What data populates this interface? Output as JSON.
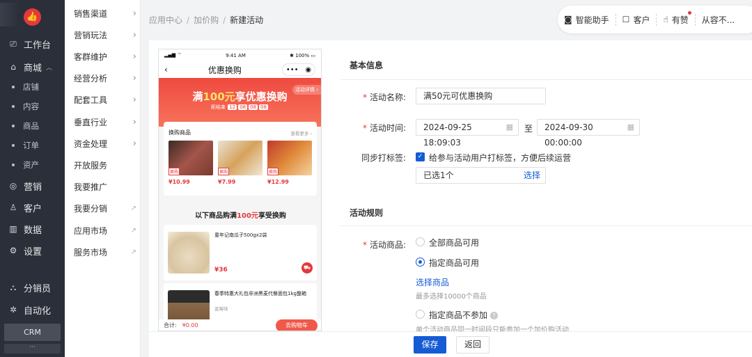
{
  "sidebar": {
    "items": [
      {
        "label": "工作台",
        "icon": "workbench-icon",
        "glyph": "⎚"
      },
      {
        "label": "商城",
        "icon": "shop-icon",
        "glyph": "⌂",
        "expanded": true
      },
      {
        "label": "店铺",
        "sub": true
      },
      {
        "label": "内容",
        "sub": true
      },
      {
        "label": "商品",
        "sub": true
      },
      {
        "label": "订单",
        "sub": true
      },
      {
        "label": "资产",
        "sub": true
      },
      {
        "label": "营销",
        "icon": "marketing-icon",
        "glyph": "◎"
      },
      {
        "label": "客户",
        "icon": "customer-icon",
        "glyph": "♙"
      },
      {
        "label": "数据",
        "icon": "data-icon",
        "glyph": "▥"
      },
      {
        "label": "设置",
        "icon": "settings-icon",
        "glyph": "⚙"
      },
      {
        "label": "分销员",
        "icon": "distributor-icon",
        "glyph": "⛬"
      },
      {
        "label": "自动化",
        "icon": "automation-icon",
        "glyph": "✲"
      }
    ],
    "crm": "CRM",
    "more": "···"
  },
  "submenu": {
    "items": [
      {
        "label": "销售渠道",
        "arrow": "chevron"
      },
      {
        "label": "营销玩法",
        "arrow": "chevron"
      },
      {
        "label": "客群维护",
        "arrow": "chevron"
      },
      {
        "label": "经营分析",
        "arrow": "chevron"
      },
      {
        "label": "配套工具",
        "arrow": "chevron"
      },
      {
        "label": "垂直行业",
        "arrow": "chevron"
      },
      {
        "label": "资金处理",
        "arrow": "chevron"
      },
      {
        "label": "开放服务",
        "arrow": "none"
      },
      {
        "label": "我要推广",
        "arrow": "none"
      },
      {
        "label": "我要分销",
        "arrow": "external"
      },
      {
        "label": "应用市场",
        "arrow": "external"
      },
      {
        "label": "服务市场",
        "arrow": "external"
      }
    ]
  },
  "breadcrumb": {
    "items": [
      "应用中心",
      "加价购",
      "新建活动"
    ],
    "sep": "/"
  },
  "topbar": {
    "assistant": "智能助手",
    "service": "客户",
    "likes": "有赞",
    "user": "从容不..."
  },
  "preview": {
    "status_time": "9:41 AM",
    "status_batt": "100%",
    "nav_title": "优惠换购",
    "banner_pre": "满",
    "banner_amount": "100元",
    "banner_post": "享优惠换购",
    "banner_tag": "活动详情 ›",
    "countdown_label": "距结束",
    "countdown": [
      "12",
      "08",
      "08",
      "08"
    ],
    "swap_title": "换购商品",
    "swap_more": "查看更多 ›",
    "swap_label": "换购",
    "swap_prices": [
      "¥10.99",
      "¥7.99",
      "¥12.99"
    ],
    "section_pre": "以下商品购满",
    "section_amount": "100元",
    "section_post": "享受换购",
    "goods": [
      {
        "name": "童年记南瓜子500gx2袋",
        "sub": "",
        "price": "¥36"
      },
      {
        "name": "春季特惠大礼包非洲黑麦代餐面包1kg整箱",
        "sub": "蓝莓味",
        "price": ""
      }
    ],
    "footer_total": "合计:",
    "footer_amount": "¥0.00",
    "footer_btn": "去购物车"
  },
  "form": {
    "basic_title": "基本信息",
    "name_label": "活动名称:",
    "name_value": "满50元可优惠换购",
    "time_label": "活动时间:",
    "time_start": "2024-09-25 18:09:03",
    "time_to": "至",
    "time_end": "2024-09-30 00:00:00",
    "tag_label": "同步打标签:",
    "tag_check_text": "给参与活动用户打标签，方便后续运营",
    "tag_selected": "已选1个",
    "tag_select_link": "选择",
    "rule_title": "活动规则",
    "goods_label": "活动商品:",
    "opt_all": "全部商品可用",
    "opt_specified": "指定商品可用",
    "select_goods": "选择商品",
    "select_hint": "最多选择10000个商品",
    "opt_exclude": "指定商品不参加",
    "exclude_hint": "单个活动商品同一时间段只能参加一个加价购活动",
    "selected_option": "opt_specified"
  },
  "footer": {
    "save": "保存",
    "back": "返回"
  },
  "colors": {
    "primary": "#155bd4",
    "danger": "#e4393c",
    "sidebar": "#2b2f3a"
  }
}
